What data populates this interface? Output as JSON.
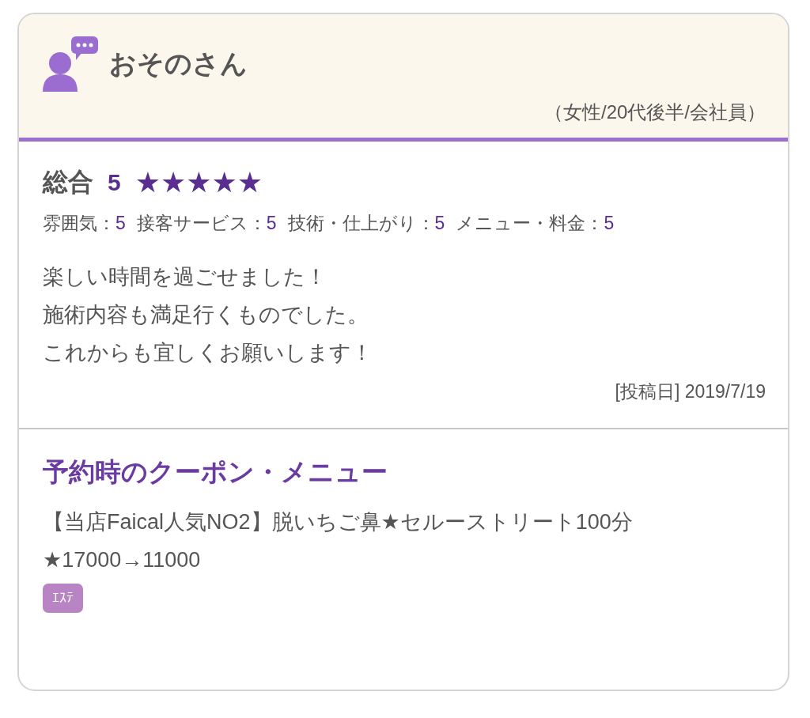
{
  "reviewer": {
    "name": "おそのさん",
    "profile": "（女性/20代後半/会社員）"
  },
  "overall": {
    "label": "総合",
    "score": "5",
    "stars": 5
  },
  "ratings": [
    {
      "label": "雰囲気：",
      "value": "5"
    },
    {
      "label": "接客サービス：",
      "value": "5"
    },
    {
      "label": "技術・仕上がり：",
      "value": "5"
    },
    {
      "label": "メニュー・料金：",
      "value": "5"
    }
  ],
  "comment": [
    "楽しい時間を過ごせました！",
    "施術内容も満足行くものでした。",
    "これからも宜しくお願いします！"
  ],
  "posted": "[投稿日] 2019/7/19",
  "coupon": {
    "heading": "予約時のクーポン・メニュー",
    "text": "【当店Faical人気NO2】脱いちご鼻★セルーストリート100分★17000→11000",
    "tag": "ｴｽﾃ"
  }
}
